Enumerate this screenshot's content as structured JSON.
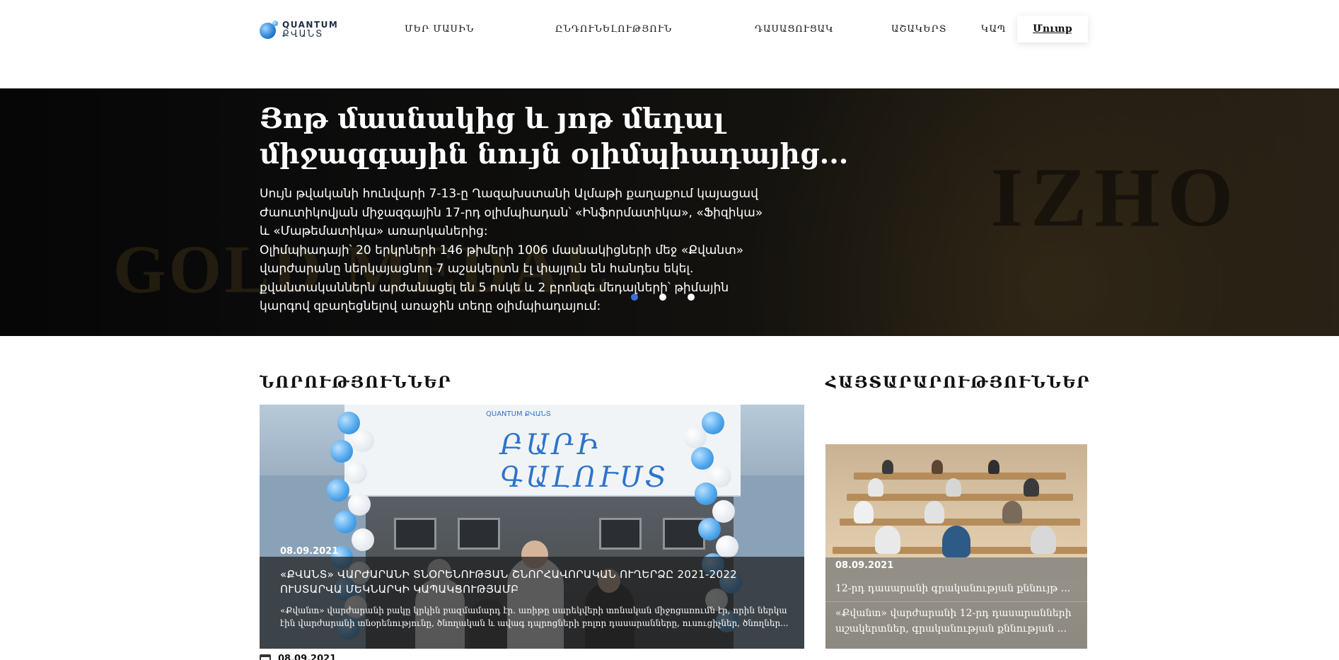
{
  "header": {
    "logo": {
      "line1": "QUANTUM",
      "line2": "ՔՎԱՆՏ"
    },
    "nav": [
      {
        "label": "ՄԵՐ ՄԱՍԻՆ"
      },
      {
        "label": "ԸՆԴՈՒՆԵԼՈՒԹՅՈՒՆ"
      },
      {
        "label": "ԴԱՍԱՑՈՒՑԱԿ"
      },
      {
        "label": "ԱՇԱԿԵՐՏ"
      },
      {
        "label": "ԿԱՊ"
      }
    ],
    "login_label": "Մուտք"
  },
  "hero": {
    "title": "Յոթ մասնակից և յոթ մեդալ միջազգային նույն օլիմպիադայից...",
    "paragraphs": [
      "Սույն թվականի հունվարի 7-13-ը Ղազախստանի Ալմաթի քաղաքում կայացավ Ժաուտիկովյան միջազգային 17-րդ օլիմպիադան՝ «Ինֆորմատիկա», «Ֆիզիկա» և «Մաթեմատիկա» առարկաներից:",
      "Օլիմպիադայի՝ 20 երկրների 146 թիմերի 1006 մասնակիցների մեջ «Քվանտ» վարժարանը ներկայացնող 7 աշակերտն էլ փայլուն են հանդես եկել.",
      "քվանտականներն արժանացել են 5 ոսկե և 2 բրոնզե մեդալների՝ թիմային կարգով զբաղեցնելով առաջին տեղը օլիմպիադայում:"
    ],
    "background_words": {
      "left": "GOLD MEDAL",
      "right": "IZHO"
    },
    "slider": {
      "count": 3,
      "active": 1
    }
  },
  "news": {
    "section_title": "ՆՈՐՈՒԹՅՈՒՆՆԵՐ",
    "card": {
      "banner_text": "ԲԱՐԻ ԳԱԼՈՒՍՏ",
      "banner_logo": "QUANTUM ՔՎԱՆՏ",
      "date": "08.09.2021",
      "headline": "«ՔՎԱՆՏ» ՎԱՐԺԱՐԱՆԻ ՏՆՕՐԵՆՈՒԹՅԱՆ ՇՆՈՐՀԱՎՈՐԱԿԱՆ ՈՒՂԵՐՁԸ 2021-2022 ՈՒՍՏԱՐՎԱ ՄԵԿՆԱՐԿԻ ԿԱՊԱԿՑՈՒԹՅԱՄԲ",
      "excerpt": "«Քվանտ» վարժարանի բակը կրկին բազմամարդ էր. առիթը սարեկվերի տոնական միջոցառումն էր, որին ներկա էին վարժարանի տնօրենությունը, ծնողական և ավագ դպրոցների բոլոր դասարանները, ուսուցիչներ, ծնողներ..."
    },
    "below_date": "08.09.2021"
  },
  "announcements": {
    "section_title": "ՀԱՅՏԱՐԱՐՈՒԹՅՈՒՆՆԵՐ",
    "card": {
      "date": "08.09.2021",
      "headline": "12-րդ դասարանի գրականության քննույթ ...",
      "excerpt": "«Քվանտ» վարժարանի 12-րդ դասարանների աշակերտներ, գրականության քննության ..."
    }
  },
  "colors": {
    "accent": "#3b6fd8",
    "brand_blue": "#2f86d6",
    "text": "#111111"
  }
}
